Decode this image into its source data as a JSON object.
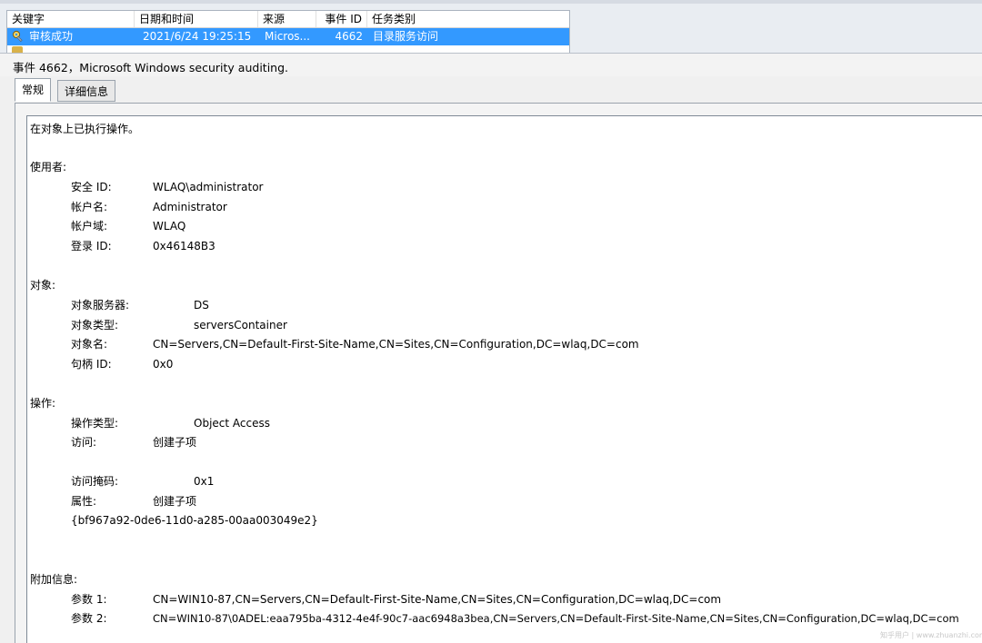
{
  "event_list": {
    "columns": [
      "关键字",
      "日期和时间",
      "来源",
      "事件 ID",
      "任务类别"
    ],
    "selected_row": {
      "keyword": "审核成功",
      "datetime": "2021/6/24 19:25:15",
      "source": "Micros...",
      "event_id": "4662",
      "task_category": "目录服务访问",
      "icon": "key-icon"
    }
  },
  "detail": {
    "title": "事件 4662，Microsoft Windows security auditing.",
    "tabs": [
      "常规",
      "详细信息"
    ],
    "active_tab": "常规",
    "description": "在对象上已执行操作。",
    "subject": {
      "heading": "使用者:",
      "rows": [
        {
          "label": "安全 ID:",
          "value": "WLAQ\\administrator"
        },
        {
          "label": "帐户名:",
          "value": "Administrator"
        },
        {
          "label": "帐户域:",
          "value": "WLAQ"
        },
        {
          "label": "登录 ID:",
          "value": "0x46148B3"
        }
      ]
    },
    "object": {
      "heading": "对象:",
      "rows": [
        {
          "label": "对象服务器:",
          "value": "DS"
        },
        {
          "label": "对象类型:",
          "value": "serversContainer"
        },
        {
          "label": "对象名:",
          "value": "CN=Servers,CN=Default-First-Site-Name,CN=Sites,CN=Configuration,DC=wlaq,DC=com"
        },
        {
          "label": "句柄 ID:",
          "value": "0x0"
        }
      ]
    },
    "operation": {
      "heading": "操作:",
      "rows": [
        {
          "label": "操作类型:",
          "value": "Object Access"
        },
        {
          "label": "访问:",
          "value": "创建子项"
        },
        {
          "label": "访问掩码:",
          "value": "0x1"
        },
        {
          "label": "属性:",
          "value": "创建子项"
        }
      ],
      "guid": "{bf967a92-0de6-11d0-a285-00aa003049e2}"
    },
    "additional": {
      "heading": "附加信息:",
      "rows": [
        {
          "label": "参数 1:",
          "value": "CN=WIN10-87,CN=Servers,CN=Default-First-Site-Name,CN=Sites,CN=Configuration,DC=wlaq,DC=com"
        },
        {
          "label": "参数 2:",
          "value": "CN=WIN10-87\\0ADEL:eaa795ba-4312-4e4f-90c7-aac6948a3bea,CN=Servers,CN=Default-First-Site-Name,CN=Sites,CN=Configuration,DC=wlaq,DC=com"
        }
      ]
    }
  },
  "watermark": "知乎用户 | www.zhuanzhi.com"
}
